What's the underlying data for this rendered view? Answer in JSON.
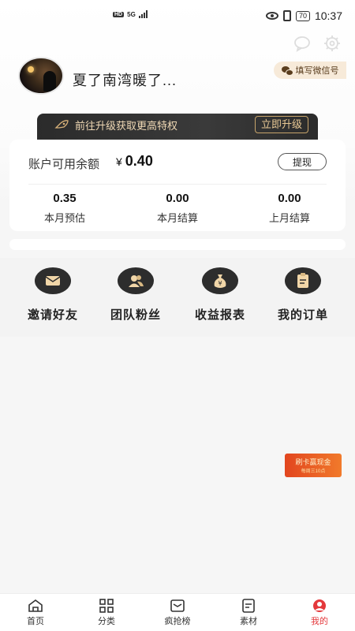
{
  "status_bar": {
    "hd": "HD",
    "network": "5G",
    "battery": "70",
    "time": "10:37"
  },
  "profile": {
    "nickname": "夏了南湾暖了...",
    "wechat_button": "填写微信号"
  },
  "upgrade": {
    "text": "前往升级获取更高特权",
    "button": "立即升级"
  },
  "balance": {
    "label": "账户可用余额",
    "currency": "¥",
    "value": "0.40",
    "withdraw": "提现",
    "stats": [
      {
        "value": "0.35",
        "label": "本月预估"
      },
      {
        "value": "0.00",
        "label": "本月结算"
      },
      {
        "value": "0.00",
        "label": "上月结算"
      }
    ]
  },
  "menu": [
    {
      "label": "邀请好友",
      "icon": "envelope-icon"
    },
    {
      "label": "团队粉丝",
      "icon": "people-icon"
    },
    {
      "label": "收益报表",
      "icon": "money-bag-icon"
    },
    {
      "label": "我的订单",
      "icon": "clipboard-icon"
    }
  ],
  "ad": {
    "title": "刷卡赢现金",
    "sub": "每周三10点"
  },
  "bottom_nav": [
    {
      "label": "首页",
      "icon": "home-icon"
    },
    {
      "label": "分类",
      "icon": "grid-icon"
    },
    {
      "label": "疯抢榜",
      "icon": "ranking-icon"
    },
    {
      "label": "素材",
      "icon": "material-icon"
    },
    {
      "label": "我的",
      "icon": "user-icon",
      "active": true
    }
  ]
}
